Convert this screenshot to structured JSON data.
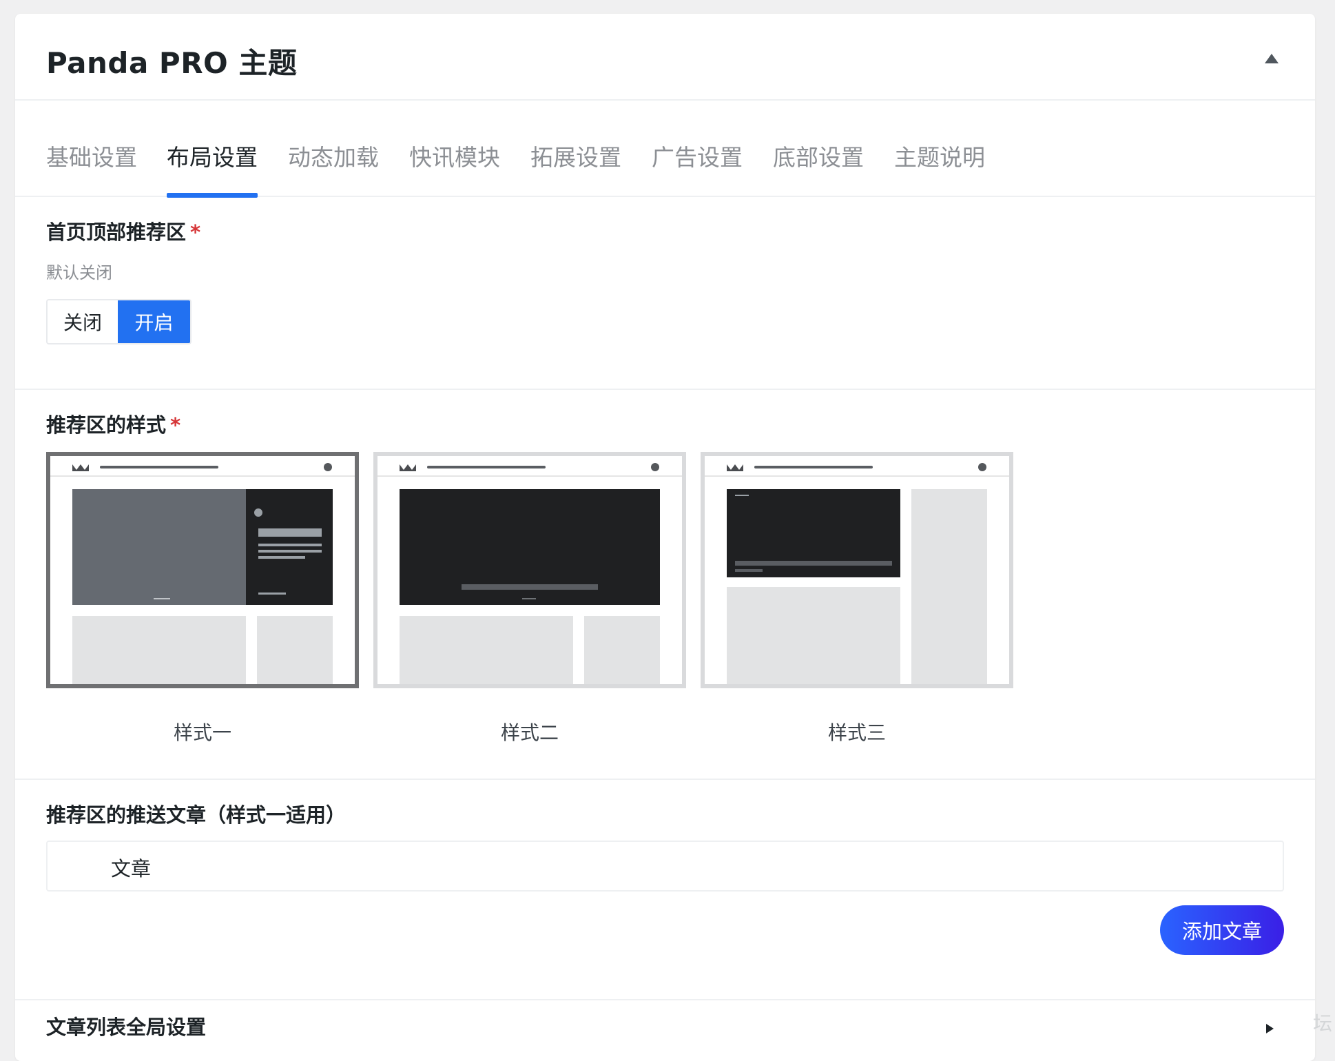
{
  "panel": {
    "title": "Panda PRO 主题"
  },
  "tabs": [
    {
      "label": "基础设置"
    },
    {
      "label": "布局设置"
    },
    {
      "label": "动态加载"
    },
    {
      "label": "快讯模块"
    },
    {
      "label": "拓展设置"
    },
    {
      "label": "广告设置"
    },
    {
      "label": "底部设置"
    },
    {
      "label": "主题说明"
    }
  ],
  "active_tab": "布局设置",
  "fields": {
    "top_recommend": {
      "label": "首页顶部推荐区",
      "required_mark": "*",
      "description": "默认关闭",
      "options": [
        "关闭",
        "开启"
      ],
      "selected": "开启"
    },
    "recommend_style": {
      "label": "推荐区的样式",
      "required_mark": "*",
      "options": [
        "样式一",
        "样式二",
        "样式三"
      ],
      "selected": "样式一"
    },
    "recommend_posts": {
      "label": "推荐区的推送文章（样式一适用）",
      "list_header": "文章",
      "add_button": "添加文章"
    },
    "post_list_global": {
      "label": "文章列表全局设置"
    }
  },
  "colors": {
    "accent": "#2271f1",
    "add_button_gradient": [
      "#2a63ff",
      "#3a1fe6"
    ],
    "required": "#d63638",
    "selected_card_border": "#6f7072"
  },
  "watermark_text": "坛"
}
